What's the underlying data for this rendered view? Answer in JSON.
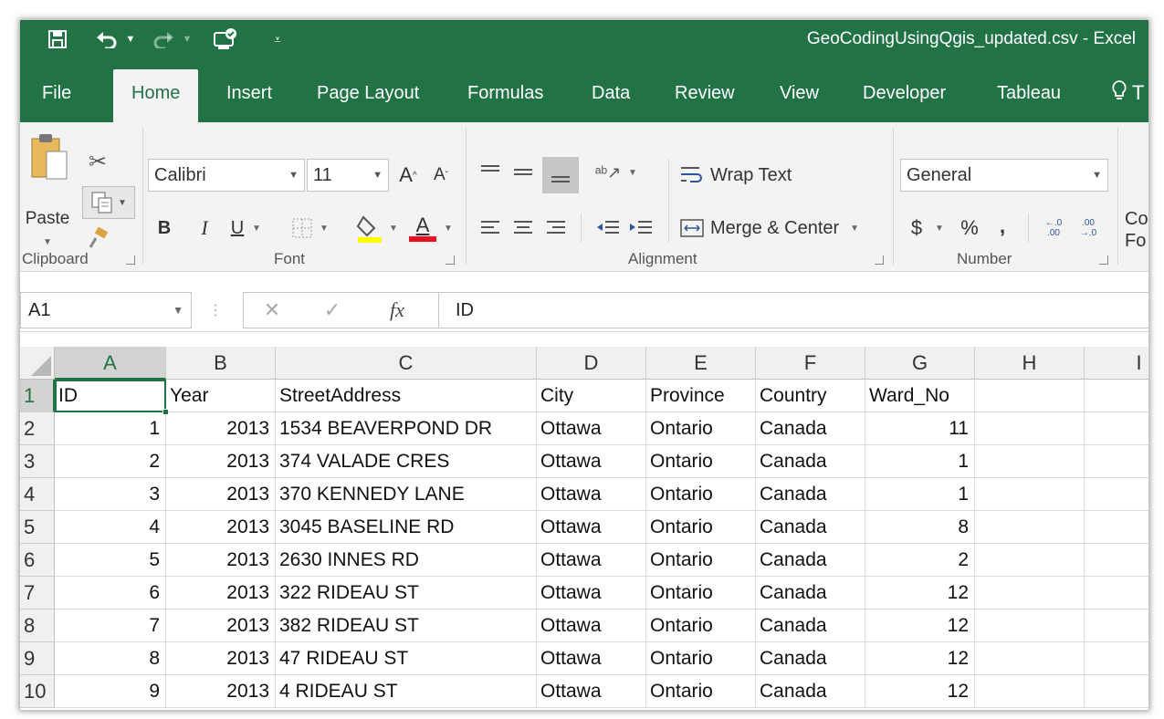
{
  "window": {
    "title": "GeoCodingUsingQgis_updated.csv  -  Excel"
  },
  "quick_access": {
    "icons": [
      "save-icon",
      "undo-icon",
      "redo-icon",
      "touch-mode-icon",
      "customize-icon"
    ]
  },
  "tabs": [
    "File",
    "Home",
    "Insert",
    "Page Layout",
    "Formulas",
    "Data",
    "Review",
    "View",
    "Developer",
    "Tableau"
  ],
  "tell_me_fragment": "T",
  "ribbon": {
    "clipboard": {
      "paste_label": "Paste",
      "group_label": "Clipboard"
    },
    "font": {
      "name": "Calibri",
      "size": "11",
      "bold": "B",
      "italic": "I",
      "underline": "U",
      "grow": "A",
      "shrink": "A",
      "font_color_glyph": "A",
      "group_label": "Font"
    },
    "alignment": {
      "wrap_text": "Wrap Text",
      "merge_center": "Merge & Center",
      "group_label": "Alignment"
    },
    "number": {
      "format": "General",
      "currency": "$",
      "percent": "%",
      "comma": ",",
      "inc_decimal": "←.0 .00",
      "dec_decimal": ".00 →.0",
      "group_label": "Number"
    },
    "styles_fragment_1": "Co",
    "styles_fragment_2": "Fo"
  },
  "formula_bar": {
    "name_box": "A1",
    "cancel": "✕",
    "enter": "✓",
    "fx": "fx",
    "content": "ID"
  },
  "colors": {
    "excel_green": "#217346",
    "ribbon_bg": "#f3f3f3",
    "font_color_bar": "#e81123",
    "highlight_bar": "#ffff00"
  },
  "sheet": {
    "columns": [
      "A",
      "B",
      "C",
      "D",
      "E",
      "F",
      "G",
      "H",
      "I"
    ],
    "row_numbers": [
      "1",
      "2",
      "3",
      "4",
      "5",
      "6",
      "7",
      "8",
      "9",
      "10"
    ],
    "rows": [
      [
        "ID",
        "Year",
        "StreetAddress",
        "City",
        "Province",
        "Country",
        "Ward_No",
        "",
        ""
      ],
      [
        "1",
        "2013",
        "1534 BEAVERPOND DR",
        "Ottawa",
        "Ontario",
        "Canada",
        "11",
        "",
        ""
      ],
      [
        "2",
        "2013",
        "374 VALADE  CRES",
        "Ottawa",
        "Ontario",
        "Canada",
        "1",
        "",
        ""
      ],
      [
        "3",
        "2013",
        "370 KENNEDY  LANE",
        "Ottawa",
        "Ontario",
        "Canada",
        "1",
        "",
        ""
      ],
      [
        "4",
        "2013",
        "3045 BASELINE  RD",
        "Ottawa",
        "Ontario",
        "Canada",
        "8",
        "",
        ""
      ],
      [
        "5",
        "2013",
        "2630 INNES  RD",
        "Ottawa",
        "Ontario",
        "Canada",
        "2",
        "",
        ""
      ],
      [
        "6",
        "2013",
        "322 RIDEAU  ST",
        "Ottawa",
        "Ontario",
        "Canada",
        "12",
        "",
        ""
      ],
      [
        "7",
        "2013",
        "382 RIDEAU  ST",
        "Ottawa",
        "Ontario",
        "Canada",
        "12",
        "",
        ""
      ],
      [
        "8",
        "2013",
        "47 RIDEAU  ST",
        "Ottawa",
        "Ontario",
        "Canada",
        "12",
        "",
        ""
      ],
      [
        "9",
        "2013",
        "4 RIDEAU  ST",
        "Ottawa",
        "Ontario",
        "Canada",
        "12",
        "",
        ""
      ]
    ]
  }
}
